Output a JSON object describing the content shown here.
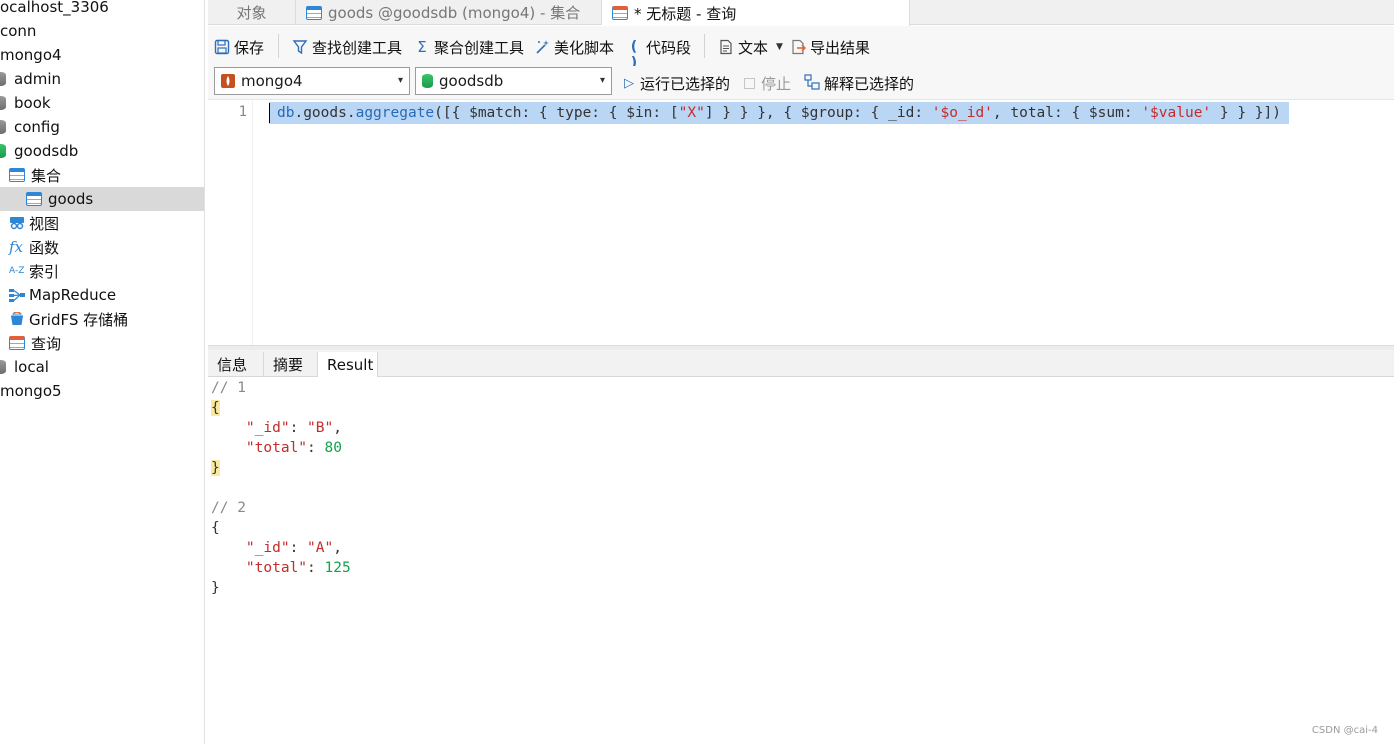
{
  "sidebar": {
    "items": [
      {
        "label": "ocalhost_3306"
      },
      {
        "label": "conn"
      },
      {
        "label": "mongo4"
      },
      {
        "label": "admin"
      },
      {
        "label": "book"
      },
      {
        "label": "config"
      },
      {
        "label": "goodsdb"
      },
      {
        "label": "集合"
      },
      {
        "label": "goods"
      },
      {
        "label": "视图"
      },
      {
        "label": "函数"
      },
      {
        "label": "索引"
      },
      {
        "label": "MapReduce"
      },
      {
        "label": "GridFS 存储桶"
      },
      {
        "label": "查询"
      },
      {
        "label": "local"
      },
      {
        "label": "mongo5"
      }
    ]
  },
  "tabs": [
    {
      "label": "对象"
    },
    {
      "label": "goods @goodsdb (mongo4) - 集合"
    },
    {
      "label": "* 无标题 - 查询"
    }
  ],
  "toolbar": {
    "save": "保存",
    "find_builder": "查找创建工具",
    "aggregate_builder": "聚合创建工具",
    "beautify": "美化脚本",
    "snippet": "代码段",
    "text": "文本",
    "export": "导出结果"
  },
  "selectors": {
    "connection": "mongo4",
    "database": "goodsdb",
    "run_selected": "运行已选择的",
    "stop": "停止",
    "explain_selected": "解释已选择的"
  },
  "editor": {
    "line_number": "1",
    "tokens": {
      "db": "db",
      "dot1": ".",
      "goods": "goods",
      "dot2": ".",
      "aggregate": "aggregate",
      "p1": "([{ $match: { type: { $in: [",
      "s1": "\"X\"",
      "p2": "] } } }, { $group: { _id: ",
      "s2": "'$o_id'",
      "p3": ", total: { $sum: ",
      "s3": "'$value'",
      "p4": " } } }])"
    }
  },
  "result_tabs": [
    {
      "label": "信息"
    },
    {
      "label": "摘要"
    },
    {
      "label": "Result"
    }
  ],
  "results": [
    {
      "comment": "// 1",
      "id_key": "\"_id\"",
      "id_val": "\"B\"",
      "total_key": "\"total\"",
      "total_val": "80"
    },
    {
      "comment": "// 2",
      "id_key": "\"_id\"",
      "id_val": "\"A\"",
      "total_key": "\"total\"",
      "total_val": "125"
    }
  ],
  "watermark": "CSDN @cai-4"
}
